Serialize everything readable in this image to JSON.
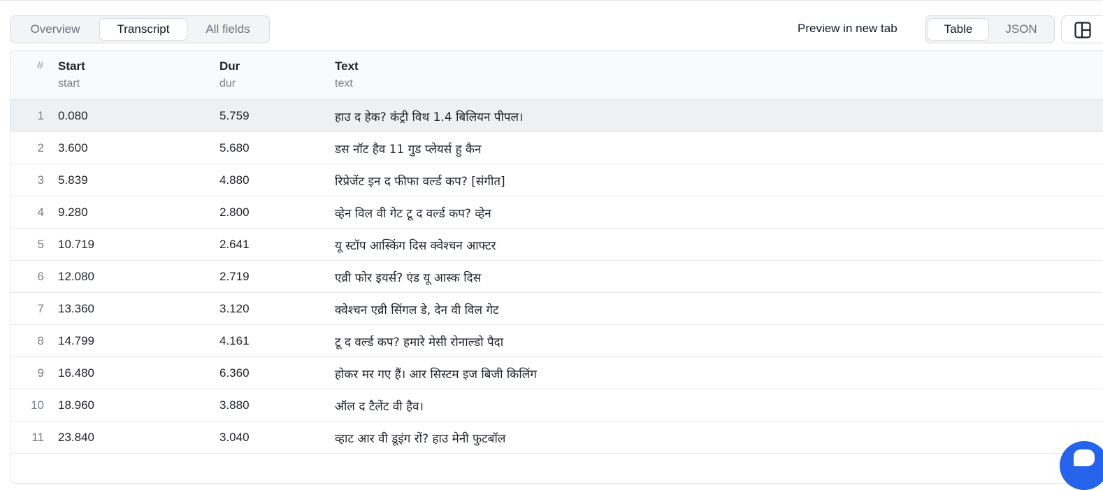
{
  "tabs": [
    {
      "label": "Overview",
      "active": false
    },
    {
      "label": "Transcript",
      "active": true
    },
    {
      "label": "All fields",
      "active": false
    }
  ],
  "toolbar": {
    "preview_label": "Preview in new tab",
    "views": [
      {
        "label": "Table",
        "active": true
      },
      {
        "label": "JSON",
        "active": false
      }
    ],
    "layout_icon": "layout-panels-icon"
  },
  "table": {
    "headers": {
      "number": "#",
      "start": {
        "label": "Start",
        "key": "start"
      },
      "dur": {
        "label": "Dur",
        "key": "dur"
      },
      "text": {
        "label": "Text",
        "key": "text"
      }
    },
    "rows": [
      {
        "n": "1",
        "start": "0.080",
        "dur": "5.759",
        "text": "हाउ द हेक? कंट्री विथ 1.4 बिलियन पीपल।"
      },
      {
        "n": "2",
        "start": "3.600",
        "dur": "5.680",
        "text": "डस नॉट हैव 11 गुड प्लेयर्स हु कैन"
      },
      {
        "n": "3",
        "start": "5.839",
        "dur": "4.880",
        "text": "रिप्रेजेंट इन द फीफा वर्ल्ड कप? [संगीत]"
      },
      {
        "n": "4",
        "start": "9.280",
        "dur": "2.800",
        "text": "व्हेन विल वी गेट टू द वर्ल्ड कप? व्हेन"
      },
      {
        "n": "5",
        "start": "10.719",
        "dur": "2.641",
        "text": "यू स्टॉप आस्किंग दिस क्वेश्चन आफ्टर"
      },
      {
        "n": "6",
        "start": "12.080",
        "dur": "2.719",
        "text": "एव्री फोर इयर्स? एंड यू आस्क दिस"
      },
      {
        "n": "7",
        "start": "13.360",
        "dur": "3.120",
        "text": "क्वेश्चन एव्री सिंगल डे, देन वी विल गेट"
      },
      {
        "n": "8",
        "start": "14.799",
        "dur": "4.161",
        "text": "टू द वर्ल्ड कप? हमारे मेसी रोनाल्डो पैदा"
      },
      {
        "n": "9",
        "start": "16.480",
        "dur": "6.360",
        "text": "होकर मर गए हैं। आर सिस्टम इज बिजी किलिंग"
      },
      {
        "n": "10",
        "start": "18.960",
        "dur": "3.880",
        "text": "ऑल द टैलेंट वी हैव।"
      },
      {
        "n": "11",
        "start": "23.840",
        "dur": "3.040",
        "text": "व्हाट आर वी डूइंग रों? हाउ मेनी फुटबॉल"
      }
    ]
  },
  "fab": {
    "icon": "chat-icon",
    "color": "#2563eb"
  }
}
